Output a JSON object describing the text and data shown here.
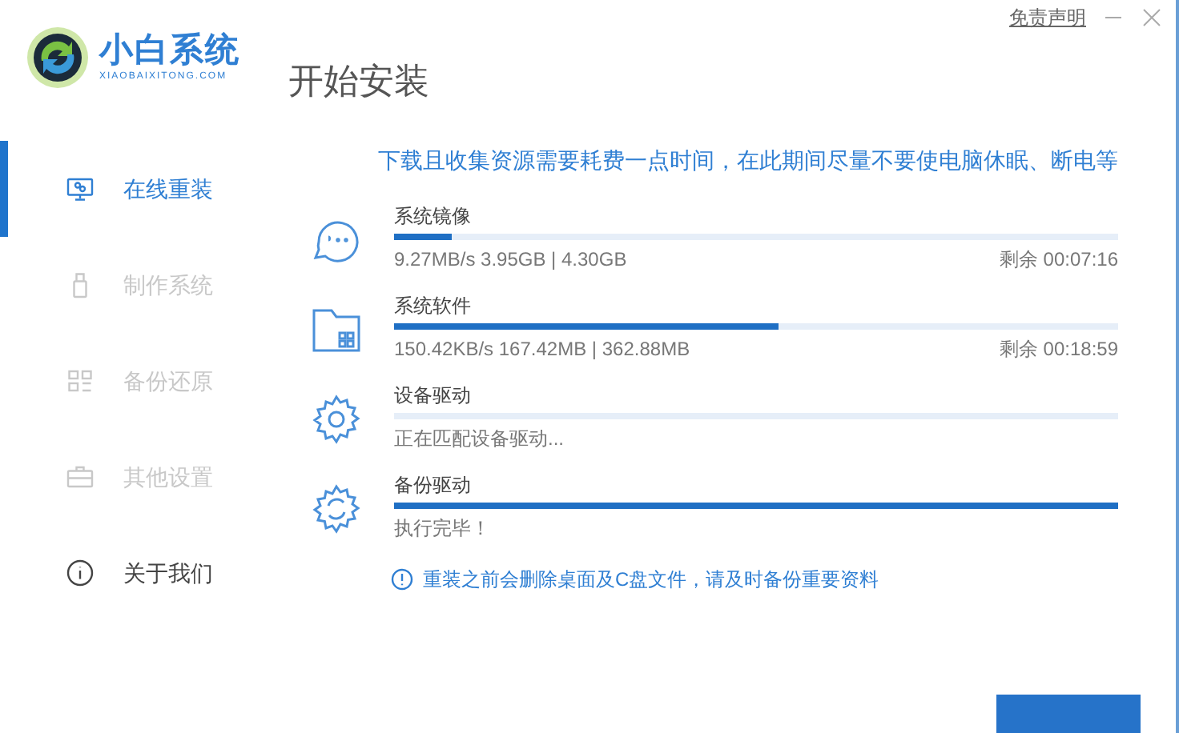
{
  "app": {
    "name": "小白系统",
    "domain": "XIAOBAIXITONG.COM"
  },
  "window": {
    "title": "开始安装",
    "disclaimer_link": "免责声明"
  },
  "sidebar": {
    "items": [
      {
        "label": "在线重装",
        "selected": true,
        "disabled": false
      },
      {
        "label": "制作系统",
        "selected": false,
        "disabled": true
      },
      {
        "label": "备份还原",
        "selected": false,
        "disabled": true
      },
      {
        "label": "其他设置",
        "selected": false,
        "disabled": true
      },
      {
        "label": "关于我们",
        "selected": false,
        "disabled": false
      }
    ]
  },
  "notice": "下载且收集资源需要耗费一点时间，在此期间尽量不要使电脑休眠、断电等",
  "tasks": [
    {
      "name": "系统镜像",
      "level": 0.08,
      "status": "9.27MB/s 3.95GB | 4.30GB",
      "remaining": "剩余 00:07:16"
    },
    {
      "name": "系统软件",
      "level": 0.53,
      "status": "150.42KB/s 167.42MB | 362.88MB",
      "remaining": "剩余 00:18:59"
    },
    {
      "name": "设备驱动",
      "level": 0,
      "status": "正在匹配设备驱动..."
    },
    {
      "name": "备份驱动",
      "level": 1,
      "status": "执行完毕！"
    }
  ],
  "warning": "重装之前会删除桌面及C盘文件，请及时备份重要资料"
}
